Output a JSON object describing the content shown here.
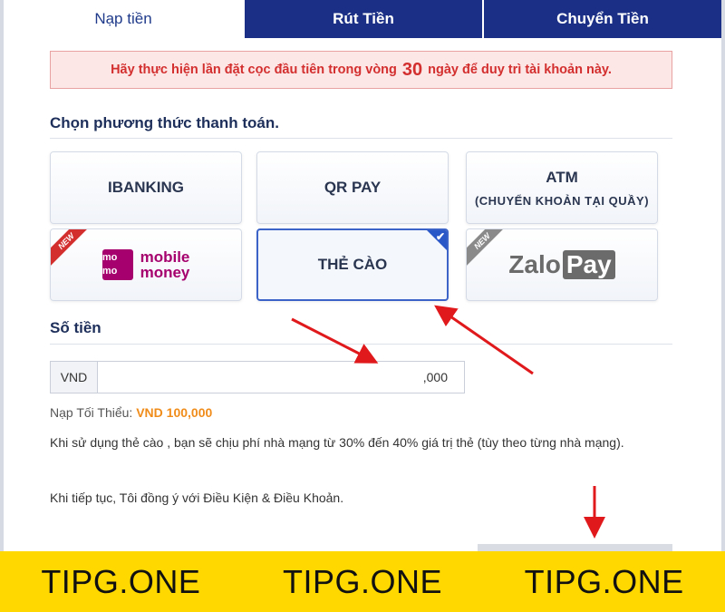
{
  "tabs": [
    {
      "label": "Nạp tiền"
    },
    {
      "label": "Rút Tiền"
    },
    {
      "label": "Chuyển Tiền"
    }
  ],
  "alert": {
    "before": "Hãy thực hiện lần đặt cọc đầu tiên trong vòng",
    "number": "30",
    "after": "ngày để duy trì tài khoản này."
  },
  "payment": {
    "title": "Chọn phương thức thanh toán.",
    "options": {
      "ibanking": "IBANKING",
      "qrpay": "QR PAY",
      "atm": "ATM",
      "atm_sub": "(CHUYỂN KHOẢN TẠI QUẦY)",
      "momo_box": [
        "mo",
        "mo"
      ],
      "momo_line1": "mobile",
      "momo_line2": "money",
      "the_cao": "THẺ CÀO",
      "zalo": "Zalo",
      "zalo_pay": "Pay",
      "new_badge": "NEW"
    },
    "selected": "THẺ CÀO"
  },
  "amount": {
    "title": "Số tiền",
    "currency": "VND",
    "suffix": ",000"
  },
  "minimum": {
    "label": "Nạp Tối Thiểu:",
    "value": "VND 100,000"
  },
  "note": "Khi sử dụng thẻ cào , bạn sẽ chịu phí nhà mạng từ 30% đến 40% giá trị thẻ (tùy theo từng nhà mạng).",
  "agreement": "Khi tiếp tục, Tôi đồng ý với Điều Kiện & Điều Khoản.",
  "watermark": [
    "TIPG.ONE",
    "TIPG.ONE",
    "TIPG.ONE"
  ],
  "colors": {
    "tab_dark": "#1a2f85",
    "alert_text": "#d32f2f",
    "selected_border": "#3c64c8",
    "min_value": "#f08c1a",
    "arrow": "#e0191c",
    "watermark_bg": "#ffd800"
  },
  "icons": [
    "check-icon",
    "momo-logo",
    "zalopay-logo",
    "new-ribbon-icon",
    "arrow-annotation"
  ]
}
